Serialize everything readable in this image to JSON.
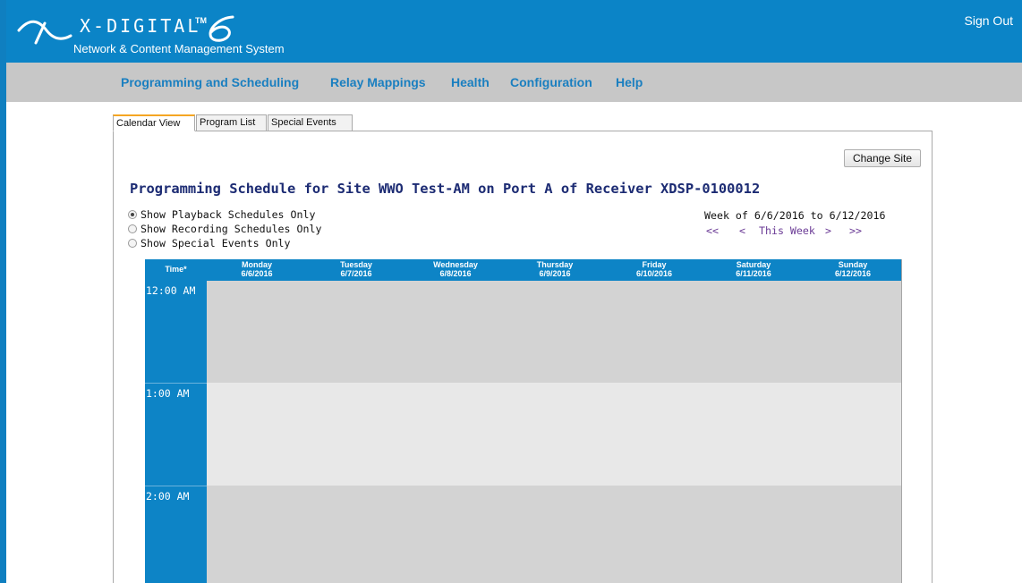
{
  "app": {
    "brand_name": "X-DIGITAL",
    "brand_tm": "TM",
    "subtitle": "Network & Content Management System",
    "sign_out": "Sign Out"
  },
  "nav": {
    "items": [
      {
        "label": "Programming and Scheduling"
      },
      {
        "label": "Relay Mappings"
      },
      {
        "label": "Health"
      },
      {
        "label": "Configuration"
      },
      {
        "label": "Help"
      }
    ]
  },
  "tabs": [
    {
      "label": "Calendar View",
      "active": true
    },
    {
      "label": "Program List",
      "active": false
    },
    {
      "label": "Special Events",
      "active": false
    }
  ],
  "page": {
    "change_site": "Change Site",
    "title": "Programming Schedule for Site WWO Test-AM on Port A of Receiver XDSP-0100012",
    "filters": [
      {
        "label": "Show Playback Schedules Only",
        "checked": true
      },
      {
        "label": "Show Recording Schedules Only",
        "checked": false
      },
      {
        "label": "Show Special Events Only",
        "checked": false
      }
    ],
    "week_range": "Week of 6/6/2016 to 6/12/2016",
    "week_nav": {
      "first": "<<",
      "prev": "<",
      "this_week": "This Week",
      "next": ">",
      "last": ">>"
    }
  },
  "calendar": {
    "time_header": "Time*",
    "days": [
      {
        "name": "Monday",
        "date": "6/6/2016"
      },
      {
        "name": "Tuesday",
        "date": "6/7/2016"
      },
      {
        "name": "Wednesday",
        "date": "6/8/2016"
      },
      {
        "name": "Thursday",
        "date": "6/9/2016"
      },
      {
        "name": "Friday",
        "date": "6/10/2016"
      },
      {
        "name": "Saturday",
        "date": "6/11/2016"
      },
      {
        "name": "Sunday",
        "date": "6/12/2016"
      }
    ],
    "hours": [
      "12:00 AM",
      "1:00 AM",
      "2:00 AM"
    ]
  },
  "colors": {
    "header_blue": "#0b84c7",
    "nav_gray": "#c7c7c7",
    "nav_link": "#1a7fc0",
    "title_navy": "#1c2b73",
    "link_purple": "#6a3a95",
    "tab_accent": "#f5a623",
    "cell_dark": "#d3d3d3",
    "cell_light": "#e8e8e8"
  }
}
